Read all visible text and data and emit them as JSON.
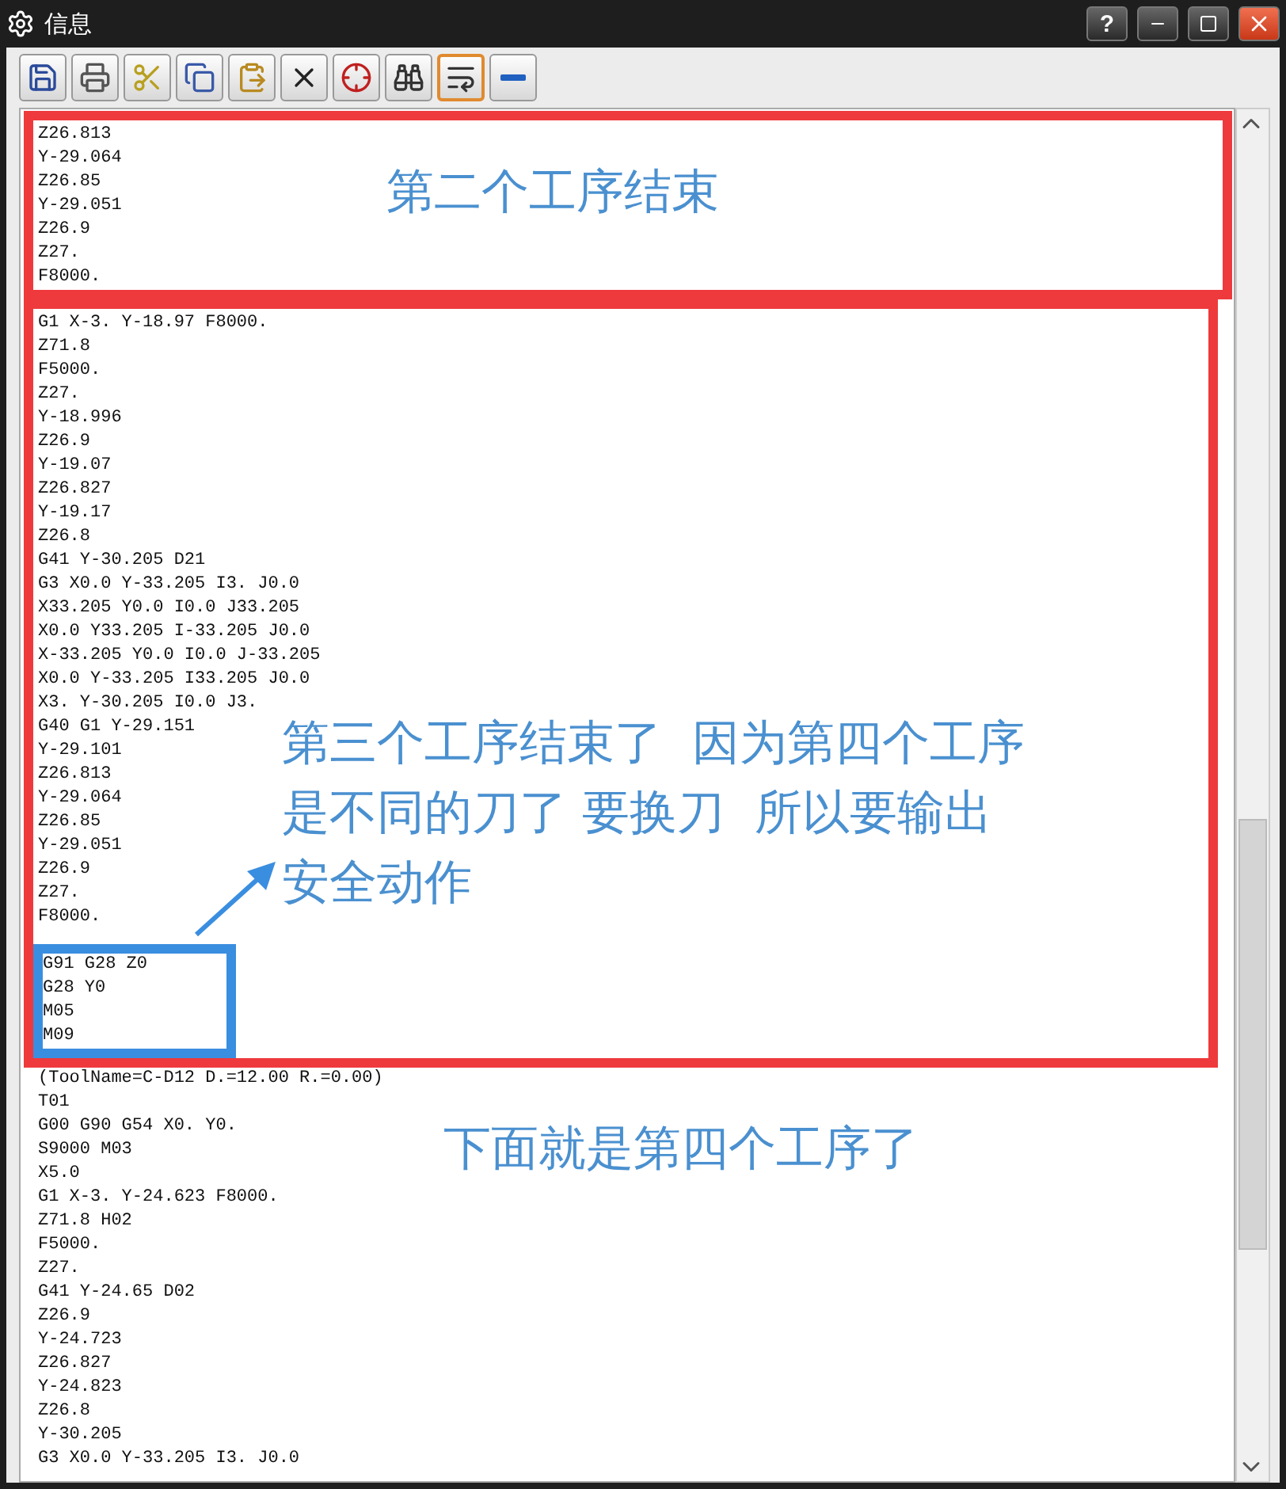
{
  "window": {
    "title": "信息",
    "buttons": [
      "?"
    ]
  },
  "toolbar": [
    {
      "selected": false
    },
    {
      "selected": false
    },
    {
      "selected": false
    },
    {
      "selected": false
    },
    {
      "selected": false
    },
    {
      "selected": false
    },
    {
      "selected": false
    },
    {
      "selected": false
    },
    {
      "selected": true
    },
    {
      "selected": false
    }
  ],
  "sections": [
    {
      "kind": "box",
      "color": "#ee3a3d",
      "lines": [
        "Z26.813",
        "Y-29.064",
        "Z26.85",
        "Y-29.051",
        "Z26.9",
        "Z27.",
        "F8000."
      ]
    },
    {
      "kind": "box",
      "color": "#ee3a3d",
      "lines": [
        "G1 X-3. Y-18.97 F8000.",
        "Z71.8",
        "F5000.",
        "Z27.",
        "Y-18.996",
        "Z26.9",
        "Y-19.07",
        "Z26.827",
        "Y-19.17",
        "Z26.8",
        "G41 Y-30.205 D21",
        "G3 X0.0 Y-33.205 I3. J0.0",
        "X33.205 Y0.0 I0.0 J33.205",
        "X0.0 Y33.205 I-33.205 J0.0",
        "X-33.205 Y0.0 I0.0 J-33.205",
        "X0.0 Y-33.205 I33.205 J0.0",
        "X3. Y-30.205 I0.0 J3.",
        "G40 G1 Y-29.151",
        "Y-29.101",
        "Z26.813",
        "Y-29.064",
        "Z26.85",
        "Y-29.051",
        "Z26.9",
        "Z27.",
        "F8000."
      ],
      "inner": {
        "color": "#3a8ee0",
        "lines": [
          "G91 G28 Z0",
          "G28 Y0",
          "M05",
          "M09"
        ]
      }
    },
    {
      "kind": "plain",
      "lines": [
        "(ToolName=C-D12 D.=12.00 R.=0.00)",
        "T01",
        "G00 G90 G54 X0. Y0.",
        "S9000 M03",
        "X5.0",
        "G1 X-3. Y-24.623 F8000.",
        "Z71.8 H02",
        "F5000.",
        "Z27.",
        "G41 Y-24.65 D02",
        "Z26.9",
        "Y-24.723",
        "Z26.827",
        "Y-24.823",
        "Z26.8",
        "Y-30.205",
        "G3 X0.0 Y-33.205 I3. J0.0"
      ]
    }
  ],
  "annotations": [
    {
      "kind": "arrow",
      "color": "#3a8ee0"
    },
    {
      "kind": "note",
      "lines": [
        "第二个工序结束"
      ]
    },
    {
      "kind": "note",
      "lines": [
        "第三个工序结束了  因为第四个工序",
        "是不同的刀了 要换刀  所以要输出",
        "安全动作"
      ]
    },
    {
      "kind": "note",
      "lines": [
        "下面就是第四个工序了"
      ]
    }
  ]
}
